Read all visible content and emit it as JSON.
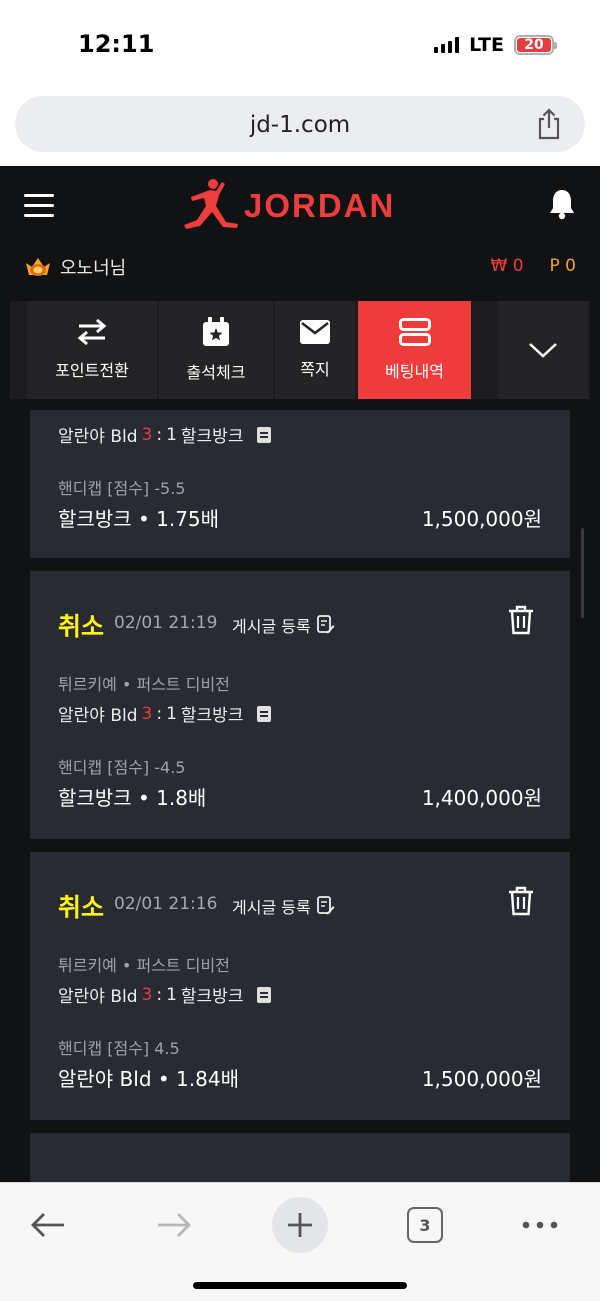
{
  "status_bar": {
    "time": "12:11",
    "network": "LTE",
    "battery": "20"
  },
  "browser": {
    "url": "jd-1.com",
    "tab_count": "3"
  },
  "site": {
    "brand": "JORDAN",
    "user": {
      "name": "오노너님"
    },
    "wallet": {
      "won": "₩ 0",
      "points": "P 0"
    },
    "nav": [
      {
        "label": "포인트전환",
        "icon": "exchange-icon"
      },
      {
        "label": "출석체크",
        "icon": "calendar-star-icon"
      },
      {
        "label": "쪽지",
        "icon": "mail-icon"
      },
      {
        "label": "베팅내역",
        "icon": "list-icon",
        "active": true
      }
    ]
  },
  "bets": [
    {
      "partial": true,
      "match": {
        "home": "알란야 Bld",
        "home_score": "3",
        "sep": ":",
        "away_score": "1",
        "away": "할크방크"
      },
      "market": "핸디캡 [점수] -5.5",
      "pick": "할크방크",
      "odds": "1.75배",
      "amount": "1,500,000원"
    },
    {
      "status": "취소",
      "time": "02/01 21:19",
      "post_label": "게시글 등록",
      "league": "튀르키예 • 퍼스트 디비전",
      "match": {
        "home": "알란야 Bld",
        "home_score": "3",
        "sep": ":",
        "away_score": "1",
        "away": "할크방크"
      },
      "market": "핸디캡 [점수] -4.5",
      "pick": "할크방크",
      "odds": "1.8배",
      "amount": "1,400,000원"
    },
    {
      "status": "취소",
      "time": "02/01 21:16",
      "post_label": "게시글 등록",
      "league": "튀르키예 • 퍼스트 디비전",
      "match": {
        "home": "알란야 Bld",
        "home_score": "3",
        "sep": ":",
        "away_score": "1",
        "away": "할크방크"
      },
      "market": "핸디캡 [점수] 4.5",
      "pick": "알란야 Bld",
      "odds": "1.84배",
      "amount": "1,500,000원"
    }
  ],
  "colors": {
    "accent": "#ee3b3b",
    "status_yellow": "#fff21a",
    "card_bg": "#292b33",
    "page_bg": "#111214"
  }
}
